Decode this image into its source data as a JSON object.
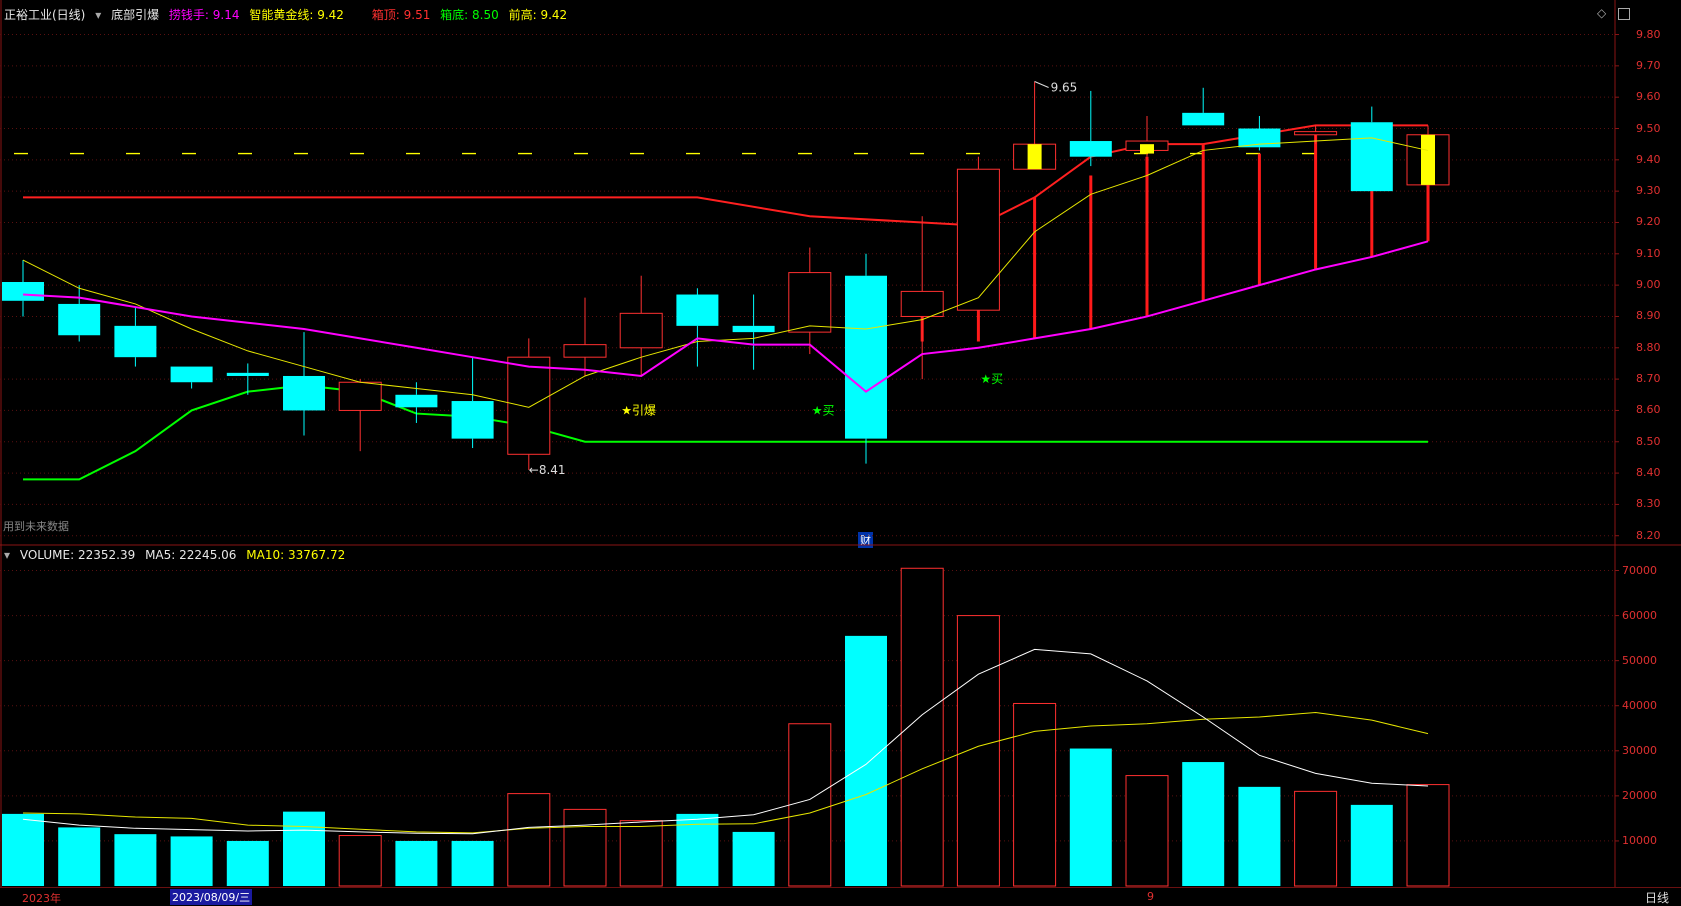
{
  "header": {
    "stock": "正裕工业(日线)",
    "indicator": "底部引爆",
    "laoqian_label": "捞钱手:",
    "laoqian_value": "9.14",
    "golden_label": "智能黄金线:",
    "golden_value": "9.42",
    "box_top_label": "箱顶:",
    "box_top_value": "9.51",
    "box_bottom_label": "箱底:",
    "box_bottom_value": "8.50",
    "prev_high_label": "前高:",
    "prev_high_value": "9.42"
  },
  "price_axis": [
    "9.80",
    "9.70",
    "9.60",
    "9.50",
    "9.40",
    "9.30",
    "9.20",
    "9.10",
    "9.00",
    "8.90",
    "8.80",
    "8.70",
    "8.60",
    "8.50",
    "8.40",
    "8.30",
    "8.20"
  ],
  "annotations": {
    "high_label": "9.65",
    "low_label": "8.41",
    "future_data": "用到未来数据",
    "finance_mark": "财",
    "signal_yinbao": "★引爆",
    "signal_buy1": "★买",
    "signal_buy2": "★买"
  },
  "volume_header": {
    "label": "VOLUME:",
    "value": "22352.39",
    "ma5_label": "MA5:",
    "ma5_value": "22245.06",
    "ma10_label": "MA10:",
    "ma10_value": "33767.72"
  },
  "volume_axis": [
    "70000",
    "60000",
    "50000",
    "40000",
    "30000",
    "20000",
    "10000"
  ],
  "bottom_bar": {
    "year": "2023年",
    "date": "2023/08/09/三",
    "month": "9",
    "period": "日线"
  },
  "colors": {
    "up": "#ff3030",
    "down": "#00ffff",
    "laoqian": "#ff00ff",
    "golden": "#ffff00",
    "box_top": "#ff2020",
    "box_bottom": "#00ff00"
  },
  "chart_data": {
    "type": "candlestick",
    "price_range": [
      8.18,
      9.84
    ],
    "volume_range": [
      0,
      73000
    ],
    "candles": [
      {
        "o": 9.01,
        "h": 9.08,
        "l": 8.9,
        "c": 8.95,
        "v": 16000
      },
      {
        "o": 8.94,
        "h": 9.0,
        "l": 8.82,
        "c": 8.84,
        "v": 13000
      },
      {
        "o": 8.87,
        "h": 8.93,
        "l": 8.74,
        "c": 8.77,
        "v": 11500
      },
      {
        "o": 8.74,
        "h": 8.74,
        "l": 8.67,
        "c": 8.69,
        "v": 11000
      },
      {
        "o": 8.72,
        "h": 8.75,
        "l": 8.65,
        "c": 8.71,
        "v": 10000
      },
      {
        "o": 8.71,
        "h": 8.85,
        "l": 8.52,
        "c": 8.6,
        "v": 16500
      },
      {
        "o": 8.6,
        "h": 8.7,
        "l": 8.47,
        "c": 8.69,
        "v": 11200
      },
      {
        "o": 8.65,
        "h": 8.69,
        "l": 8.56,
        "c": 8.61,
        "v": 10000
      },
      {
        "o": 8.63,
        "h": 8.77,
        "l": 8.48,
        "c": 8.51,
        "v": 10000
      },
      {
        "o": 8.46,
        "h": 8.83,
        "l": 8.41,
        "c": 8.77,
        "v": 20500
      },
      {
        "o": 8.77,
        "h": 8.96,
        "l": 8.71,
        "c": 8.81,
        "v": 17000
      },
      {
        "o": 8.8,
        "h": 9.03,
        "l": 8.71,
        "c": 8.91,
        "v": 14500
      },
      {
        "o": 8.97,
        "h": 8.99,
        "l": 8.74,
        "c": 8.87,
        "v": 16000
      },
      {
        "o": 8.87,
        "h": 8.97,
        "l": 8.73,
        "c": 8.85,
        "v": 12000
      },
      {
        "o": 8.85,
        "h": 9.12,
        "l": 8.78,
        "c": 9.04,
        "v": 36000
      },
      {
        "o": 9.03,
        "h": 9.1,
        "l": 8.43,
        "c": 8.51,
        "v": 55500
      },
      {
        "o": 8.9,
        "h": 9.22,
        "l": 8.7,
        "c": 8.98,
        "v": 70500
      },
      {
        "o": 8.92,
        "h": 9.41,
        "l": 8.92,
        "c": 9.37,
        "v": 60000
      },
      {
        "o": 9.37,
        "h": 9.65,
        "l": 9.37,
        "c": 9.45,
        "v": 40500
      },
      {
        "o": 9.46,
        "h": 9.62,
        "l": 9.38,
        "c": 9.41,
        "v": 30500
      },
      {
        "o": 9.43,
        "h": 9.54,
        "l": 9.41,
        "c": 9.46,
        "v": 24500
      },
      {
        "o": 9.55,
        "h": 9.63,
        "l": 9.51,
        "c": 9.51,
        "v": 27500
      },
      {
        "o": 9.5,
        "h": 9.54,
        "l": 9.43,
        "c": 9.44,
        "v": 22000
      },
      {
        "o": 9.48,
        "h": 9.51,
        "l": 9.45,
        "c": 9.49,
        "v": 21000
      },
      {
        "o": 9.52,
        "h": 9.57,
        "l": 9.3,
        "c": 9.3,
        "v": 18000
      },
      {
        "o": 9.32,
        "h": 9.51,
        "l": 9.32,
        "c": 9.48,
        "v": 22500
      }
    ],
    "yellow_bodies": [
      {
        "index": 18,
        "top": 9.45,
        "bottom": 9.37
      },
      {
        "index": 20,
        "top": 9.45,
        "bottom": 9.42
      },
      {
        "index": 25,
        "top": 9.48,
        "bottom": 9.32
      }
    ],
    "golden_line": 9.42,
    "box_top_line": [
      {
        "i": 0,
        "v": 9.28
      },
      {
        "i": 12,
        "v": 9.28
      },
      {
        "i": 14,
        "v": 9.22
      },
      {
        "i": 17,
        "v": 9.19
      },
      {
        "i": 18,
        "v": 9.28
      },
      {
        "i": 19,
        "v": 9.41
      },
      {
        "i": 20,
        "v": 9.45
      },
      {
        "i": 21,
        "v": 9.45
      },
      {
        "i": 22,
        "v": 9.48
      },
      {
        "i": 23,
        "v": 9.51
      },
      {
        "i": 25,
        "v": 9.51
      }
    ],
    "box_bottom_line": [
      {
        "i": 0,
        "v": 8.38
      },
      {
        "i": 1,
        "v": 8.38
      },
      {
        "i": 2,
        "v": 8.47
      },
      {
        "i": 3,
        "v": 8.6
      },
      {
        "i": 4,
        "v": 8.66
      },
      {
        "i": 5,
        "v": 8.68
      },
      {
        "i": 6,
        "v": 8.66
      },
      {
        "i": 7,
        "v": 8.59
      },
      {
        "i": 8,
        "v": 8.58
      },
      {
        "i": 9,
        "v": 8.55
      },
      {
        "i": 10,
        "v": 8.5
      },
      {
        "i": 25,
        "v": 8.5
      }
    ],
    "laoqian_line": [
      8.97,
      8.96,
      8.93,
      8.9,
      8.88,
      8.86,
      8.83,
      8.8,
      8.77,
      8.74,
      8.73,
      8.71,
      8.83,
      8.81,
      8.81,
      8.66,
      8.78,
      8.8,
      8.83,
      8.86,
      8.9,
      8.95,
      9.0,
      9.05,
      9.09,
      9.14
    ],
    "ma_yellow_line": [
      9.08,
      8.99,
      8.94,
      8.86,
      8.79,
      8.74,
      8.69,
      8.67,
      8.65,
      8.61,
      8.71,
      8.77,
      8.82,
      8.83,
      8.87,
      8.86,
      8.89,
      8.96,
      9.17,
      9.29,
      9.35,
      9.43,
      9.45,
      9.46,
      9.47,
      9.43
    ],
    "stem_lines": [
      {
        "i": 14,
        "top": 8.95,
        "bottom": 8.85
      },
      {
        "i": 16,
        "top": 8.9,
        "bottom": 8.82
      },
      {
        "i": 17,
        "top": 9.11,
        "bottom": 8.82
      },
      {
        "i": 18,
        "top": 9.28,
        "bottom": 8.83
      },
      {
        "i": 19,
        "top": 9.35,
        "bottom": 8.86
      },
      {
        "i": 20,
        "top": 9.41,
        "bottom": 8.9
      },
      {
        "i": 21,
        "top": 9.45,
        "bottom": 8.95
      },
      {
        "i": 22,
        "top": 9.42,
        "bottom": 9.0
      },
      {
        "i": 23,
        "top": 9.49,
        "bottom": 9.05
      },
      {
        "i": 24,
        "top": 9.39,
        "bottom": 9.09
      },
      {
        "i": 25,
        "top": 9.32,
        "bottom": 9.14
      }
    ],
    "vol_ma5": [
      14800,
      13500,
      12800,
      12500,
      12200,
      12400,
      12000,
      11700,
      11600,
      13000,
      13500,
      14200,
      14800,
      15800,
      19200,
      27000,
      38000,
      47000,
      52500,
      51500,
      45500,
      37500,
      29000,
      25000,
      22800,
      22200
    ],
    "vol_ma10": [
      16200,
      16000,
      15300,
      15000,
      13500,
      13200,
      12600,
      12000,
      11800,
      12800,
      13200,
      13200,
      13700,
      13800,
      16200,
      20300,
      26000,
      31000,
      34300,
      35500,
      36000,
      37000,
      37500,
      38500,
      36800,
      33800
    ]
  }
}
